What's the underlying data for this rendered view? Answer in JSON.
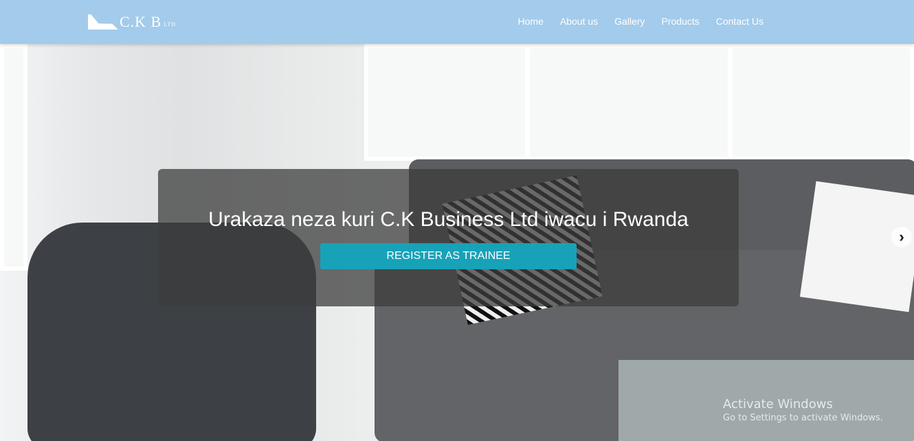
{
  "navbar": {
    "logo_text": "C.K B",
    "logo_sub": "LTD",
    "links": [
      "Home",
      "About us",
      "Gallery",
      "Products",
      "Contact Us"
    ]
  },
  "hero": {
    "headline": "Urakaza neza kuri C.K Business Ltd iwacu i Rwanda",
    "cta": "REGISTER AS TRAINEE",
    "next_icon": "chevron-right-icon"
  },
  "watermark": {
    "title": "Activate Windows",
    "subtitle": "Go to Settings to activate Windows."
  },
  "colors": {
    "navbar": "#a3cbeb",
    "cta": "#17a2b8"
  }
}
